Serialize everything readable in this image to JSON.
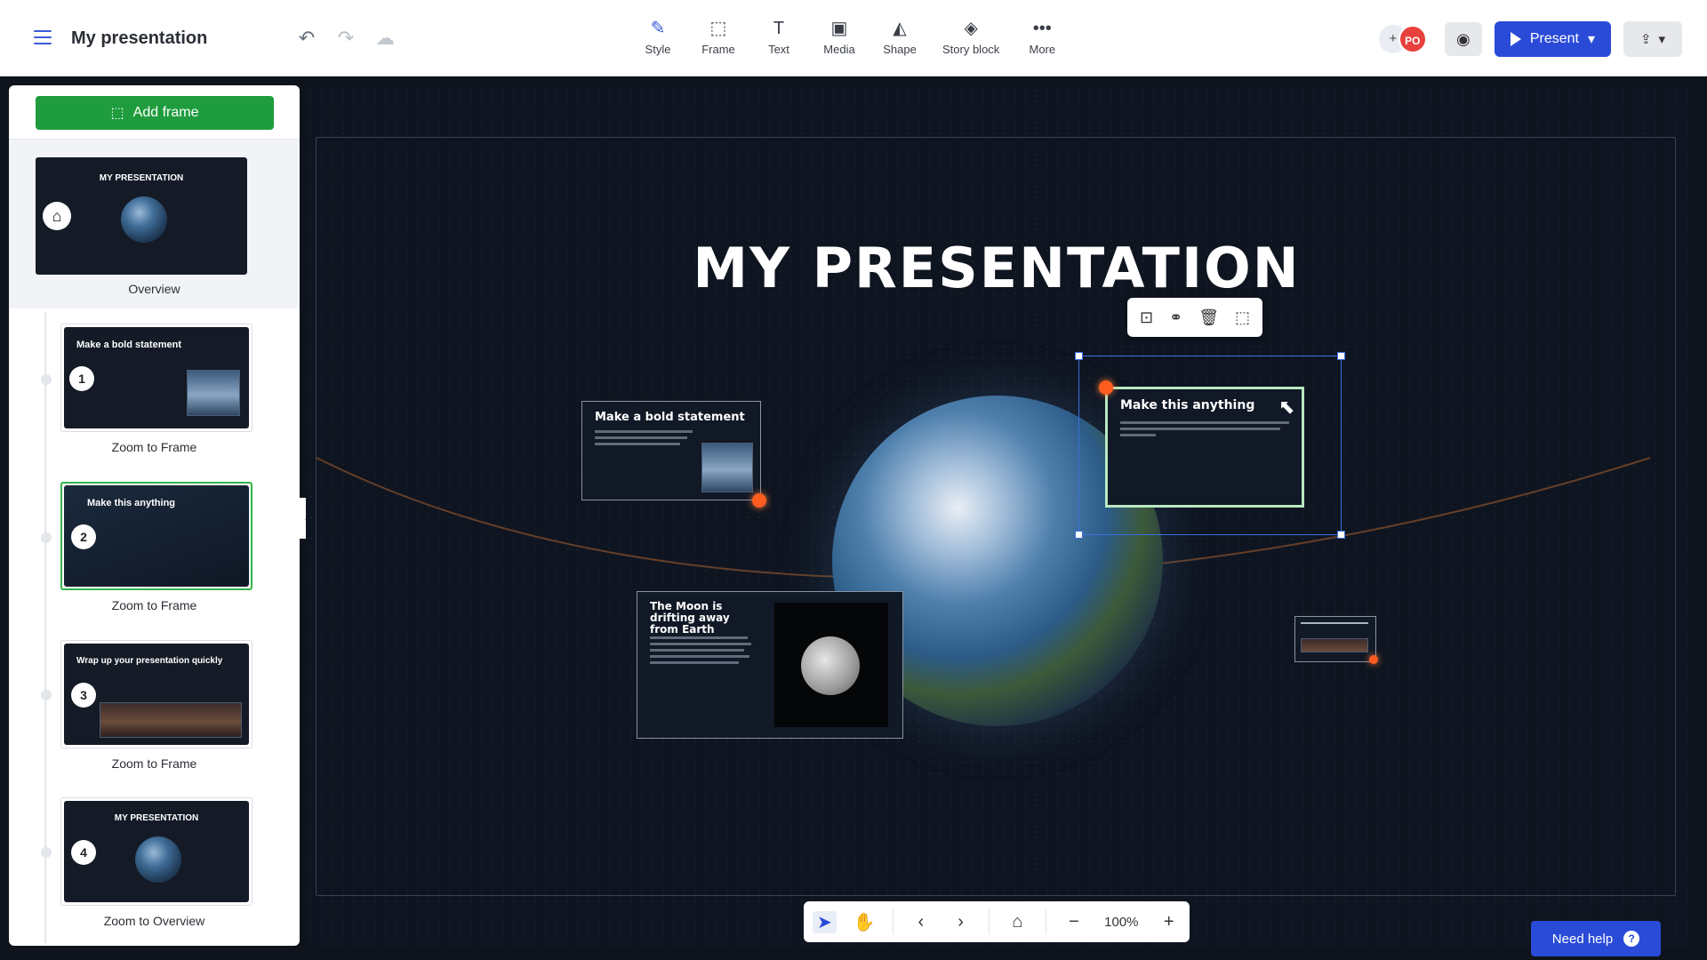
{
  "header": {
    "title": "My presentation",
    "tools": [
      {
        "icon": "style-icon",
        "label": "Style"
      },
      {
        "icon": "frame-icon",
        "label": "Frame"
      },
      {
        "icon": "text-icon",
        "label": "Text"
      },
      {
        "icon": "media-icon",
        "label": "Media"
      },
      {
        "icon": "shape-icon",
        "label": "Shape"
      },
      {
        "icon": "story-block-icon",
        "label": "Story block"
      },
      {
        "icon": "more-icon",
        "label": "More"
      }
    ],
    "avatar_initials": "PO",
    "present_label": "Present"
  },
  "sidebar": {
    "add_frame_label": "Add frame",
    "overview": {
      "thumb_title": "MY PRESENTATION",
      "label": "Overview"
    },
    "frames": [
      {
        "number": "1",
        "thumb_title": "Make a bold statement",
        "label": "Zoom to Frame"
      },
      {
        "number": "2",
        "thumb_title": "Make this anything",
        "label": "Zoom to Frame"
      },
      {
        "number": "3",
        "thumb_title": "Wrap up your presentation quickly",
        "label": "Zoom to Frame"
      },
      {
        "number": "4",
        "thumb_title": "MY PRESENTATION",
        "label": "Zoom to Overview"
      }
    ]
  },
  "canvas": {
    "title": "MY PRESENTATION",
    "cards": {
      "bold": {
        "heading": "Make a bold statement"
      },
      "anything": {
        "heading": "Make this anything"
      },
      "moon": {
        "heading": "The Moon is drifting away from Earth"
      }
    }
  },
  "bottom_nav": {
    "zoom": "100%"
  },
  "help": {
    "label": "Need help"
  },
  "colors": {
    "accent": "#2a4bd7",
    "add_frame": "#1f9d3e",
    "orbit_dot": "#ff5c1f"
  }
}
